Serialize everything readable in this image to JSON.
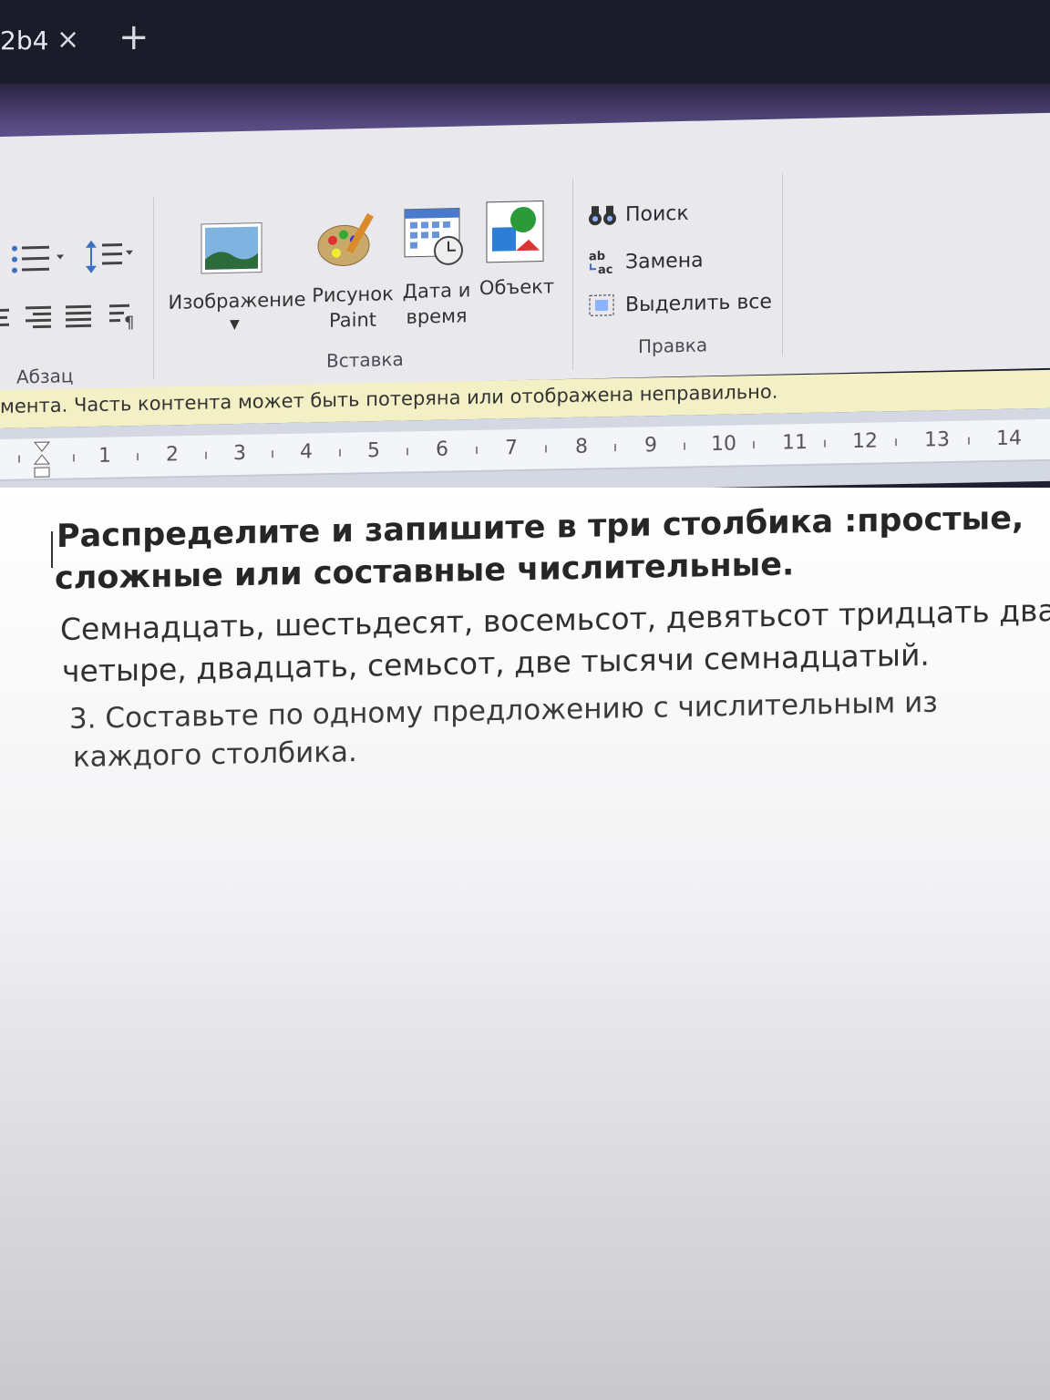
{
  "browser": {
    "tab_title": "2b4",
    "close_glyph": "×",
    "new_tab_glyph": "+"
  },
  "ribbon": {
    "paragraph_group": "Абзац",
    "insert_group": {
      "label": "Вставка",
      "image": "Изображение",
      "paint_line1": "Рисунок",
      "paint_line2": "Paint",
      "datetime_line1": "Дата и",
      "datetime_line2": "время",
      "object": "Объект"
    },
    "edit_group": {
      "label": "Правка",
      "find": "Поиск",
      "replace": "Замена",
      "select_all": "Выделить все"
    }
  },
  "notice": "мента. Часть контента может быть потеряна или отображена неправильно.",
  "ruler": {
    "numbers": [
      "1",
      "2",
      "3",
      "4",
      "5",
      "6",
      "7",
      "8",
      "9",
      "10",
      "11",
      "12",
      "13",
      "14"
    ]
  },
  "document": {
    "heading_line1": "Распределите и запишите в три столбика :простые,",
    "heading_line2": "сложные или составные числительные.",
    "para_line1": "Семнадцать, шестьдесят, восемьсот, девятьсот тридцать два,",
    "para_line2": "четыре, двадцать, семьсот, две тысячи семнадцатый.",
    "task_line1": "3. Составьте по одному  предложению с числительным из",
    "task_line2": "каждого столбика."
  }
}
